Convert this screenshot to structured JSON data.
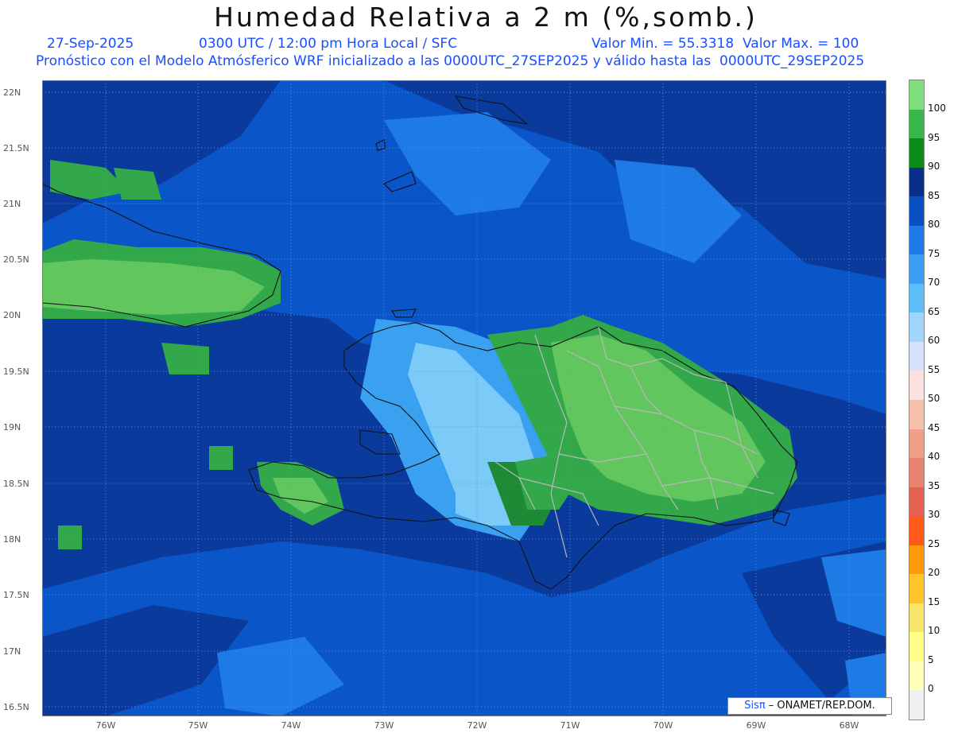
{
  "header": {
    "title": "Humedad Relativa a 2 m (%,somb.)",
    "date": "27-Sep-2025",
    "time": "0300 UTC / 12:00 pm Hora Local / SFC",
    "min_max": "Valor Min. = 55.3318  Valor Max. = 100",
    "forecast": "Pronóstico con el Modelo Atmósferico WRF inicializado a las 0000UTC_27SEP2025 y válido hasta las  0000UTC_29SEP2025"
  },
  "map": {
    "lat_labels": [
      "22N",
      "21.5N",
      "21N",
      "20.5N",
      "20N",
      "19.5N",
      "19N",
      "18.5N",
      "18N",
      "17.5N",
      "17N",
      "16.5N"
    ],
    "lon_labels": [
      "76W",
      "75W",
      "74W",
      "73W",
      "72W",
      "71W",
      "70W",
      "69W",
      "68W"
    ],
    "colors": {
      "ocean": "#0a55c8",
      "dark": "#0a3b9c",
      "light_blue": "#1e7be6",
      "lighter_blue": "#3aa0f0",
      "cyan": "#7ccaf7",
      "green": "#33a84a",
      "dark_green": "#1f8a36",
      "light_green": "#62c65f"
    }
  },
  "colorbar": {
    "labels": [
      "100",
      "95",
      "90",
      "85",
      "80",
      "75",
      "70",
      "65",
      "60",
      "55",
      "50",
      "45",
      "40",
      "35",
      "30",
      "25",
      "20",
      "15",
      "10",
      "5",
      "0"
    ],
    "colors": [
      "#7ee07c",
      "#3ab74a",
      "#0a8a16",
      "#0a2f8a",
      "#0a50c0",
      "#1f78e8",
      "#3a9ff4",
      "#5fbff8",
      "#a2d5fb",
      "#d6e2fb",
      "#fbe1df",
      "#f6c0aa",
      "#efa086",
      "#e98270",
      "#e46252",
      "#ff5a1a",
      "#ff9a0a",
      "#ffc52a",
      "#f7e66a",
      "#ffff8a",
      "#ffffb8",
      "#f0f0f0"
    ]
  },
  "credit": {
    "brand": "Sisπ",
    "text": " – ONAMET/REP.DOM."
  }
}
